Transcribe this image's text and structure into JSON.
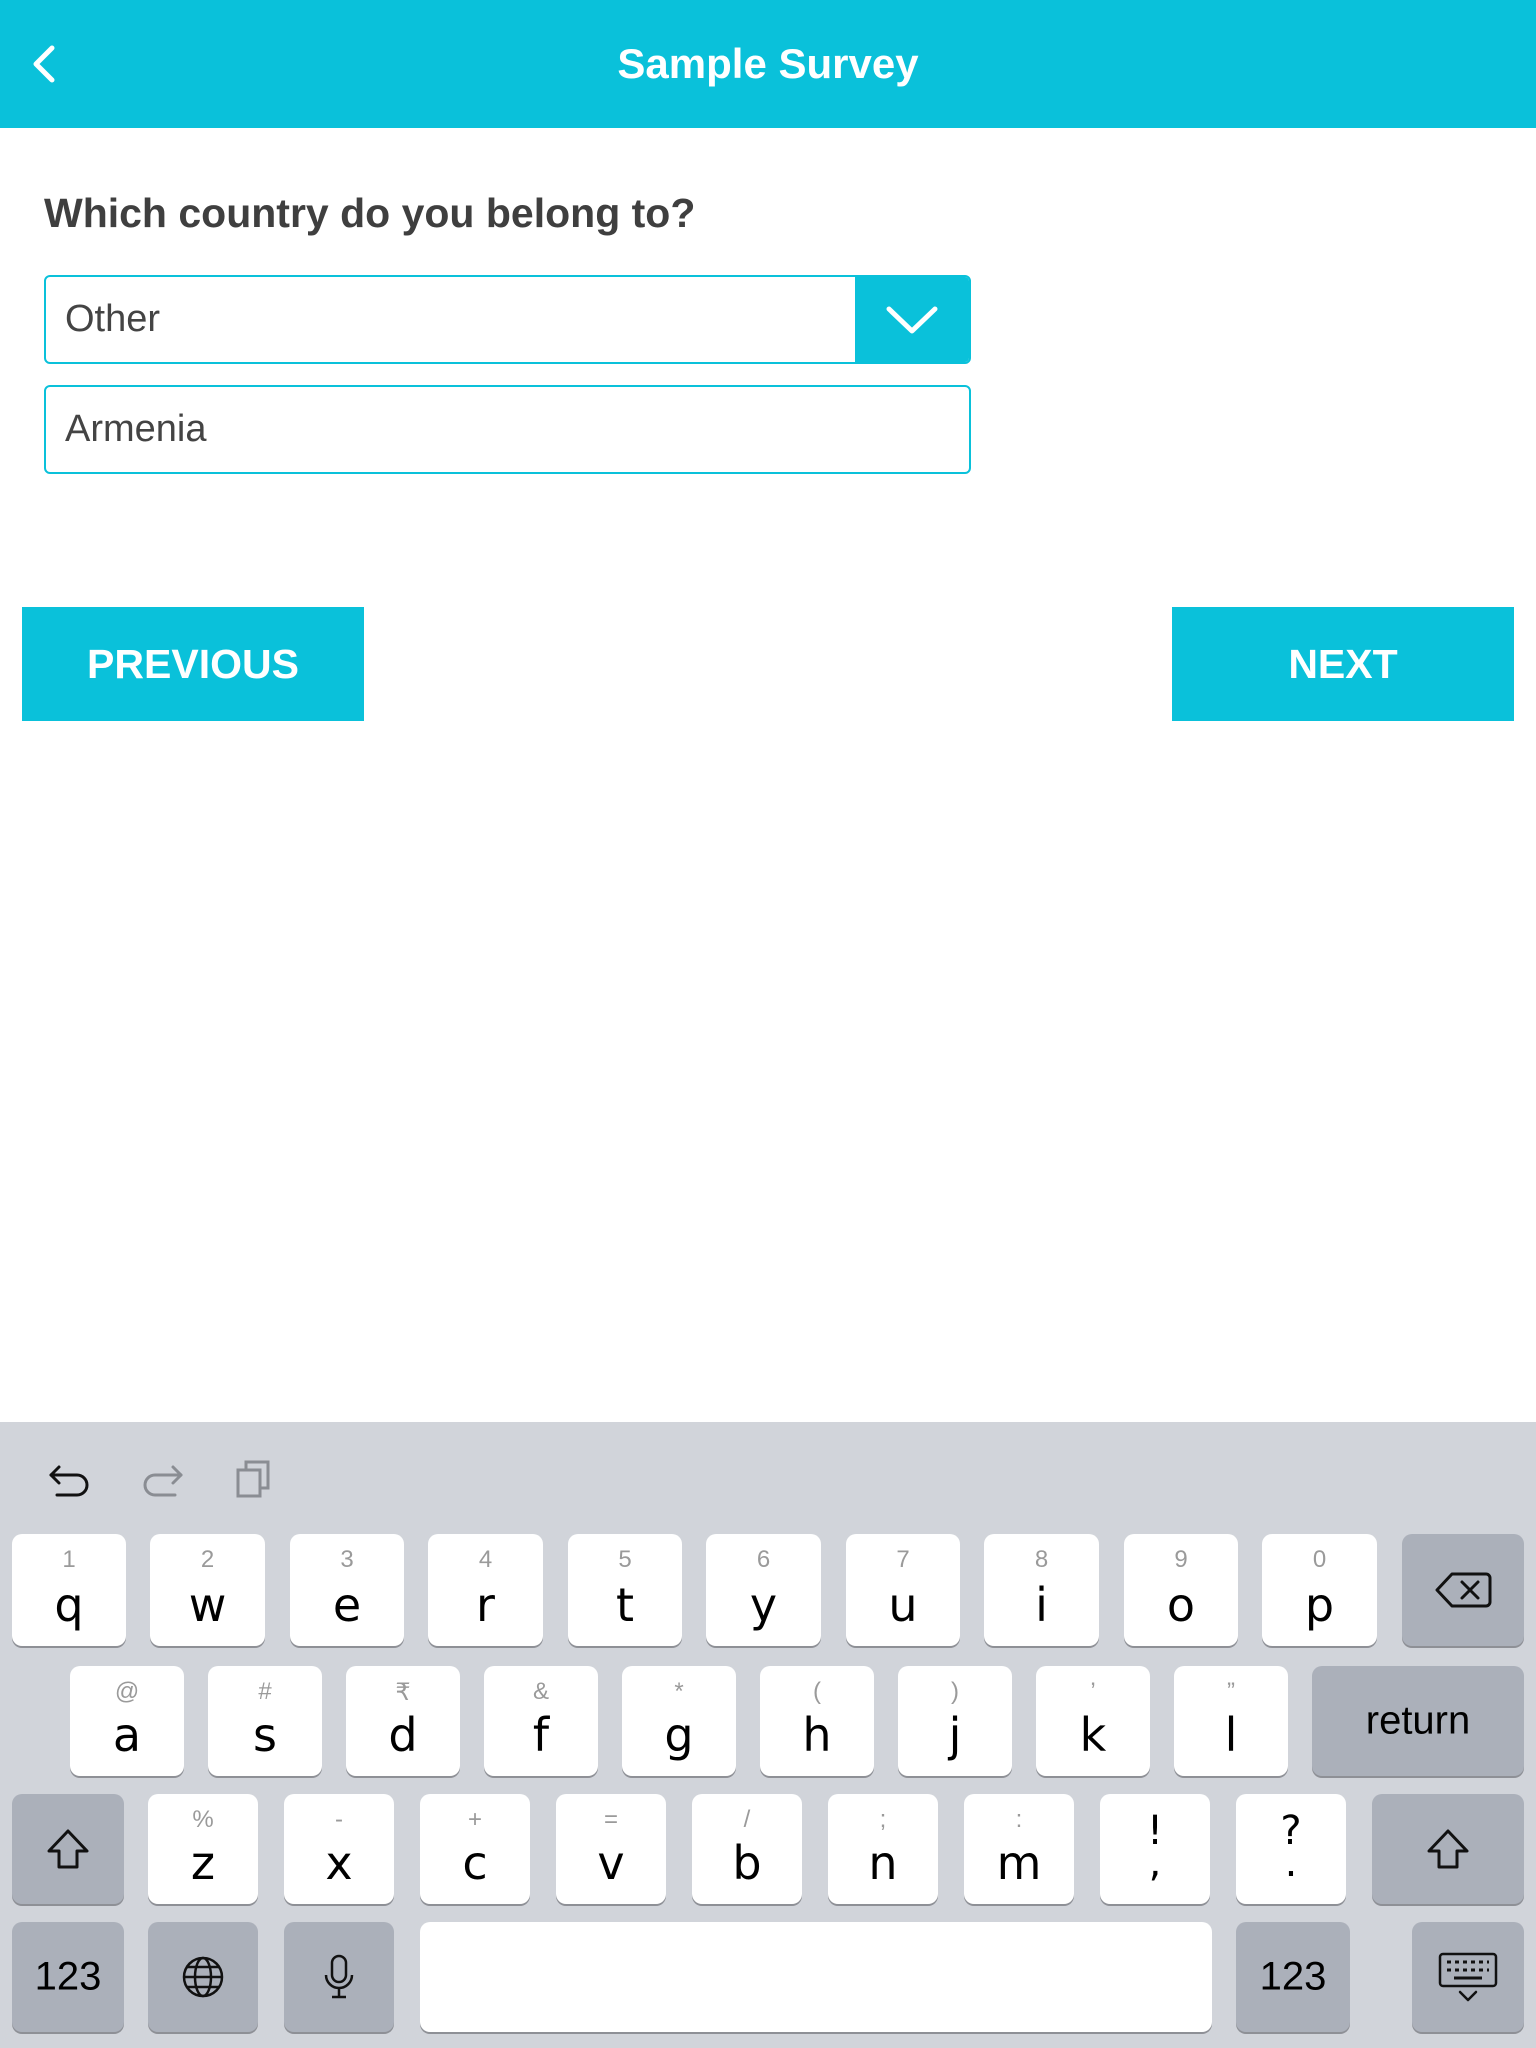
{
  "header": {
    "title": "Sample Survey",
    "back_icon": "chevron-left-icon"
  },
  "question": {
    "text": "Which country do you belong to?"
  },
  "select": {
    "value": "Other",
    "arrow_icon": "chevron-down-icon"
  },
  "other_input": {
    "value": "Armenia"
  },
  "buttons": {
    "previous": "PREVIOUS",
    "next": "NEXT"
  },
  "colors": {
    "accent": "#0ac1da",
    "keyboard_bg": "#d1d4da",
    "key": "#ffffff",
    "key_dark": "#abb0ba"
  },
  "keyboard": {
    "toolbar_icons": [
      "undo-icon",
      "redo-icon",
      "paste-icon"
    ],
    "row1": [
      {
        "alt": "1",
        "main": "q"
      },
      {
        "alt": "2",
        "main": "w"
      },
      {
        "alt": "3",
        "main": "e"
      },
      {
        "alt": "4",
        "main": "r"
      },
      {
        "alt": "5",
        "main": "t"
      },
      {
        "alt": "6",
        "main": "y"
      },
      {
        "alt": "7",
        "main": "u"
      },
      {
        "alt": "8",
        "main": "i"
      },
      {
        "alt": "9",
        "main": "o"
      },
      {
        "alt": "0",
        "main": "p"
      }
    ],
    "row2": [
      {
        "alt": "@",
        "main": "a"
      },
      {
        "alt": "#",
        "main": "s"
      },
      {
        "alt": "₹",
        "main": "d"
      },
      {
        "alt": "&",
        "main": "f"
      },
      {
        "alt": "*",
        "main": "g"
      },
      {
        "alt": "(",
        "main": "h"
      },
      {
        "alt": ")",
        "main": "j"
      },
      {
        "alt": "’",
        "main": "k"
      },
      {
        "alt": "”",
        "main": "l"
      }
    ],
    "row3": [
      {
        "alt": "%",
        "main": "z"
      },
      {
        "alt": "-",
        "main": "x"
      },
      {
        "alt": "+",
        "main": "c"
      },
      {
        "alt": "=",
        "main": "v"
      },
      {
        "alt": "/",
        "main": "b"
      },
      {
        "alt": ";",
        "main": "n"
      },
      {
        "alt": ":",
        "main": "m"
      },
      {
        "alt": "!",
        "main": ","
      },
      {
        "alt": "?",
        "main": "."
      }
    ],
    "return_label": "return",
    "numbers_label": "123",
    "delete_icon": "backspace-icon",
    "shift_icon": "shift-icon",
    "globe_icon": "globe-icon",
    "mic_icon": "microphone-icon",
    "hide_icon": "keyboard-hide-icon"
  }
}
